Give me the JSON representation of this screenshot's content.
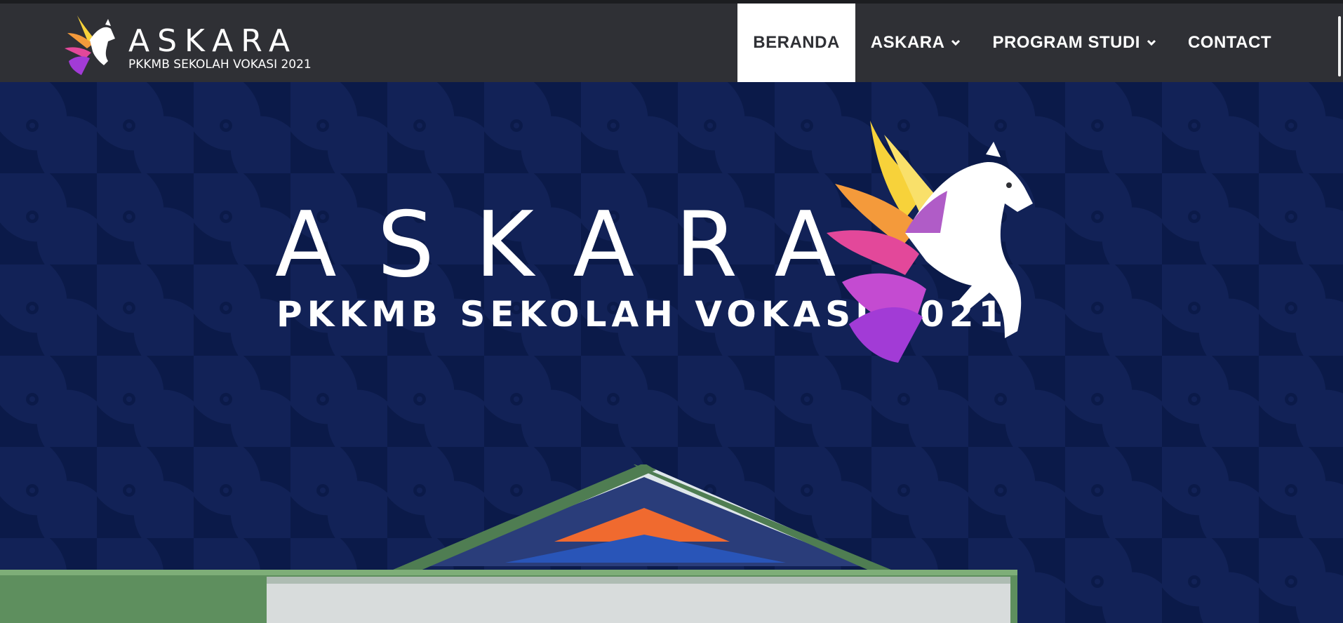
{
  "header": {
    "logo": {
      "title": "ASKARA",
      "subtitle": "PKKMB SEKOLAH VOKASI 2021"
    },
    "nav": [
      {
        "label": "BERANDA",
        "active": true,
        "dropdown": false
      },
      {
        "label": "ASKARA",
        "active": false,
        "dropdown": true
      },
      {
        "label": "PROGRAM STUDI",
        "active": false,
        "dropdown": true
      },
      {
        "label": "CONTACT",
        "active": false,
        "dropdown": false
      }
    ]
  },
  "hero": {
    "title": "ASKARA",
    "subtitle": "PKKMB SEKOLAH VOKASI 2021"
  },
  "colors": {
    "topbar": "#2f3035",
    "hero_bg": "#0b1a49",
    "active_nav_bg": "#ffffff",
    "wing_yellow": "#f7d23a",
    "wing_orange": "#f49a3b",
    "wing_pink": "#e3489a",
    "wing_purple": "#a23bd6",
    "roof_green": "#4f7d52"
  },
  "icons": {
    "logo": "pegasus-logo-icon",
    "dropdown": "chevron-down-icon",
    "hero_art": "pegasus-illustration",
    "photo": "building-roof-photo"
  }
}
